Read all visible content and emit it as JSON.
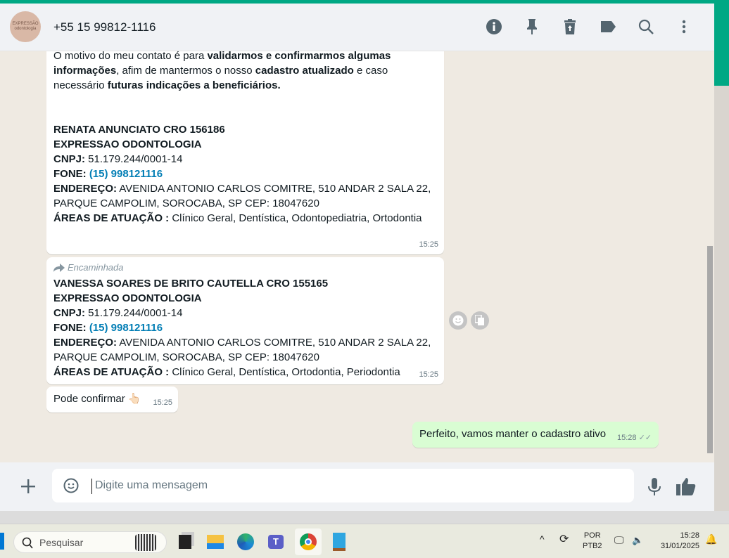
{
  "header": {
    "avatar_text": "EXPRESSÃO odontologia",
    "contact": "+55 15 99812-1116",
    "icons": [
      "info-icon",
      "pin-icon",
      "delete-icon",
      "label-icon",
      "search-icon",
      "menu-icon"
    ]
  },
  "messages": [
    {
      "p1": "O motivo do meu contato é para ",
      "b1": "validarmos e confirmarmos algumas informações",
      "p2": ", afim de mantermos o nosso ",
      "b2": "cadastro atualizado",
      "p3": " e caso necessário ",
      "b3": "futuras indicações a beneficiários.",
      "name": "RENATA ANUNCIATO CRO 156186",
      "company": "EXPRESSAO ODONTOLOGIA",
      "cnpj_label": "CNPJ:",
      "cnpj": " 51.179.244/0001-14",
      "fone_label": "FONE:",
      "fone": "(15) 998121116",
      "end_label": "ENDEREÇO:",
      "endereco": " AVENIDA ANTONIO CARLOS COMITRE, 510 ANDAR 2 SALA 22, PARQUE CAMPOLIM, SOROCABA, SP CEP: 18047620",
      "areas_label": "ÁREAS DE ATUAÇÃO :",
      "areas": " Clínico Geral, Dentística, Odontopediatria, Ortodontia",
      "time": "15:25"
    },
    {
      "forwarded": "Encaminhada",
      "name": "VANESSA SOARES DE BRITO CAUTELLA CRO 155165",
      "company": "EXPRESSAO ODONTOLOGIA",
      "cnpj_label": "CNPJ:",
      "cnpj": " 51.179.244/0001-14",
      "fone_label": "FONE:",
      "fone": "(15) 998121116",
      "end_label": "ENDEREÇO:",
      "endereco": " AVENIDA ANTONIO CARLOS COMITRE, 510 ANDAR 2 SALA 22, PARQUE CAMPOLIM, SOROCABA, SP CEP: 18047620",
      "areas_label": "ÁREAS DE ATUAÇÃO :",
      "areas": " Clínico Geral, Dentística, Ortodontia, Periodontia",
      "time": "15:25"
    },
    {
      "text": "Pode confirmar 👆🏻",
      "time": "15:25"
    },
    {
      "text": "Perfeito, vamos manter o cadastro ativo",
      "time": "15:28",
      "status": "✓✓"
    }
  ],
  "composer": {
    "placeholder": "Digite uma mensagem"
  },
  "taskbar": {
    "search": "Pesquisar",
    "lang1": "POR",
    "lang2": "PTB2",
    "time": "15:28",
    "date": "31/01/2025"
  },
  "colors": {
    "accent": "#00a884",
    "outgoing": "#d9fdd3",
    "link": "#027eb5"
  }
}
